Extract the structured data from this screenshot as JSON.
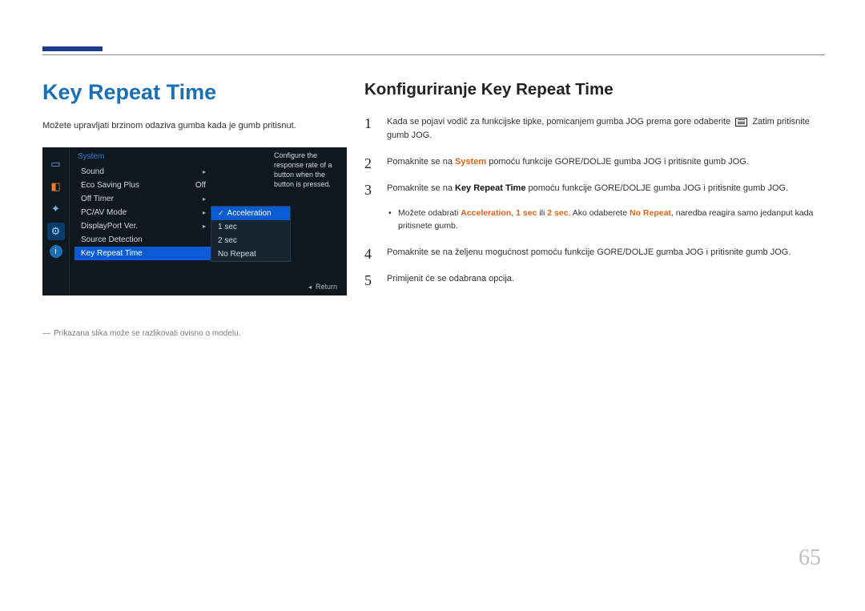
{
  "page_number": "65",
  "left": {
    "title": "Key Repeat Time",
    "desc": "Možete upravljati brzinom odaziva gumba kada je gumb pritisnut.",
    "footnote": "Prikazana slika može se razlikovati ovisno o modelu."
  },
  "osd": {
    "header": "System",
    "tooltip": "Configure the response rate of a button when the button is pressed.",
    "return_label": "Return",
    "rows": [
      {
        "label": "Sound",
        "value": "",
        "arrow": true
      },
      {
        "label": "Eco Saving Plus",
        "value": "Off",
        "arrow": false
      },
      {
        "label": "Off Timer",
        "value": "",
        "arrow": true
      },
      {
        "label": "PC/AV Mode",
        "value": "",
        "arrow": true
      },
      {
        "label": "DisplayPort Ver.",
        "value": "",
        "arrow": true
      },
      {
        "label": "Source Detection",
        "value": "",
        "arrow": false
      },
      {
        "label": "Key Repeat Time",
        "value": "",
        "arrow": false
      }
    ],
    "submenu": [
      "Acceleration",
      "1 sec",
      "2 sec",
      "No Repeat"
    ]
  },
  "right": {
    "title": "Konfiguriranje Key Repeat Time",
    "step1_a": "Kada se pojavi vodič za funkcijske tipke, pomicanjem gumba JOG prema gore odaberite ",
    "step1_b": " Zatim pritisnite gumb JOG.",
    "step2_a": "Pomaknite se na ",
    "step2_kw": "System",
    "step2_b": " pomoću funkcije GORE/DOLJE gumba JOG i pritisnite gumb JOG.",
    "step3_a": "Pomaknite se na ",
    "step3_kw": "Key Repeat Time",
    "step3_b": " pomoću funkcije GORE/DOLJE gumba JOG i pritisnite gumb JOG.",
    "step3_sub_a": "Možete odabrati ",
    "kw_accel": "Acceleration",
    "comma1": ", ",
    "kw_1sec": "1 sec",
    "ili": " ili ",
    "kw_2sec": "2 sec",
    "step3_sub_b": ". Ako odaberete ",
    "kw_norep": "No Repeat",
    "step3_sub_c": ", naredba reagira samo jedanput kada pritisnete gumb.",
    "step4": "Pomaknite se na željenu mogućnost pomoću funkcije GORE/DOLJE gumba JOG i pritisnite gumb JOG.",
    "step5": "Primijenit će se odabrana opcija."
  }
}
